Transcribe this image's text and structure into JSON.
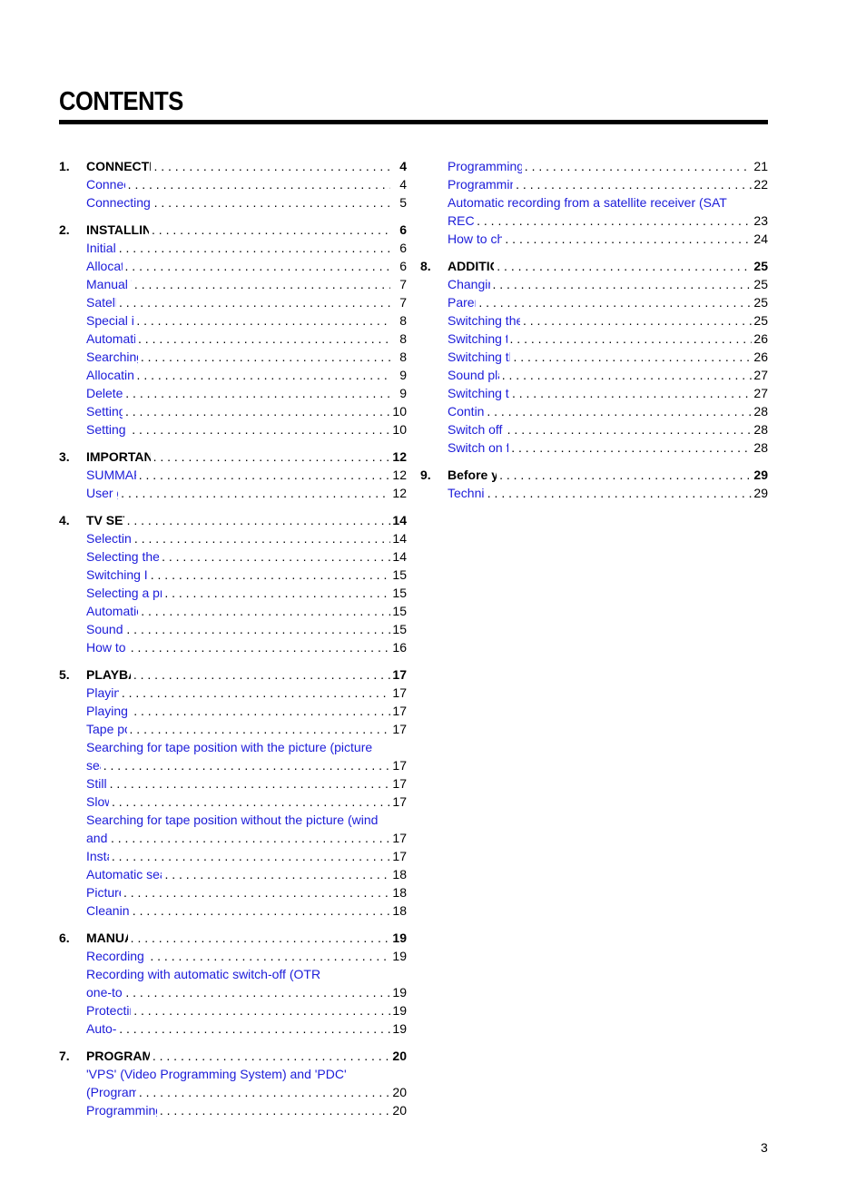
{
  "title": "CONTENTS",
  "page_number": "3",
  "link_color": "#1c1cd9",
  "left_column": [
    {
      "number": "1.",
      "title": "CONNECTING YOUR TV-VIDEO COMBI",
      "page": "4",
      "items": [
        {
          "lines": [
            "Connecting the cables"
          ],
          "page": "4"
        },
        {
          "lines": [
            "Connecting a decoder or other equipment"
          ],
          "page": "5"
        }
      ]
    },
    {
      "number": "2.",
      "title": "INSTALLING YOUR TV-VIDEO COMBI",
      "page": "6",
      "items": [
        {
          "lines": [
            "Initial installation"
          ],
          "page": "6"
        },
        {
          "lines": [
            "Allocating a decoder"
          ],
          "page": "6"
        },
        {
          "lines": [
            "Manual TV channel search"
          ],
          "page": "7"
        },
        {
          "lines": [
            "Satellite receiver"
          ],
          "page": "7"
        },
        {
          "lines": [
            "Special installation functions"
          ],
          "page": "8"
        },
        {
          "lines": [
            "Automatic TV channel search"
          ],
          "page": "8"
        },
        {
          "lines": [
            "Searching for new TV channels"
          ],
          "page": "8"
        },
        {
          "lines": [
            "Allocating a channel number"
          ],
          "page": "9"
        },
        {
          "lines": [
            "Delete a TV Channel"
          ],
          "page": "9"
        },
        {
          "lines": [
            "Setting the language"
          ],
          "page": "10"
        },
        {
          "lines": [
            "Setting the time and date"
          ],
          "page": "10"
        }
      ]
    },
    {
      "number": "3.",
      "title": "IMPORTANT NOTES FOR OPERATION",
      "page": "12",
      "items": [
        {
          "lines": [
            "SUMMARY OF USER GUIDE"
          ],
          "page": "12"
        },
        {
          "lines": [
            "User guide (OSD)"
          ],
          "page": "12"
        }
      ]
    },
    {
      "number": "4.",
      "title": "TV SET FUNCTIONS",
      "page": "14",
      "items": [
        {
          "lines": [
            "Selecting a TV programme"
          ],
          "page": "14"
        },
        {
          "lines": [
            "Selecting the picture setting (SMART PICTURE)"
          ],
          "page": "14"
        },
        {
          "lines": [
            "Switching Incredible Surround on or off"
          ],
          "page": "15"
        },
        {
          "lines": [
            "Selecting a preset sound setting (SMART SOUND)"
          ],
          "page": "15"
        },
        {
          "lines": [
            "Automatic volume control (AVL)"
          ],
          "page": "15"
        },
        {
          "lines": [
            "Sound track selection"
          ],
          "page": "15"
        },
        {
          "lines": [
            "How to read TELETEXT"
          ],
          "page": "16"
        }
      ]
    },
    {
      "number": "5.",
      "title": "PLAYBACK FUNCTIONS",
      "page": "17",
      "items": [
        {
          "lines": [
            "Playing a cassette"
          ],
          "page": "17"
        },
        {
          "lines": [
            "Playing an NTSC cassette"
          ],
          "page": "17"
        },
        {
          "lines": [
            "Tape position indication"
          ],
          "page": "17"
        },
        {
          "lines": [
            "Searching for tape position with the picture (picture",
            "search)"
          ],
          "page": "17"
        },
        {
          "lines": [
            "Still picture"
          ],
          "page": "17"
        },
        {
          "lines": [
            "Slow motion"
          ],
          "page": "17"
        },
        {
          "lines": [
            "Searching for tape position without the picture (wind",
            "and rewind)"
          ],
          "page": "17"
        },
        {
          "lines": [
            "Instant View"
          ],
          "page": "17"
        },
        {
          "lines": [
            "Automatic search for a tape position (index search)"
          ],
          "page": "18"
        },
        {
          "lines": [
            "Picture interference"
          ],
          "page": "18"
        },
        {
          "lines": [
            "Cleaning the video heads"
          ],
          "page": "18"
        }
      ]
    },
    {
      "number": "6.",
      "title": "MANUAL RECORDING",
      "page": "19",
      "items": [
        {
          "lines": [
            "Recording without automatic switch-off"
          ],
          "page": "19"
        },
        {
          "lines": [
            "Recording with automatic switch-off (OTR",
            "one-touch-recording)"
          ],
          "page": "19"
        },
        {
          "lines": [
            "Protecting your recordings"
          ],
          "page": "19"
        },
        {
          "lines": [
            "Auto-assembling"
          ],
          "page": "19"
        }
      ]
    },
    {
      "number": "7.",
      "title": "PROGRAMMED RECORDING (TIMER)",
      "page": "20",
      "items": [
        {
          "lines": [
            "'VPS' (Video Programming System) and 'PDC'",
            "(Programme Delivery Control)"
          ],
          "page": "20"
        },
        {
          "lines": [
            "Programming a recording (with 'VIDEO Plus+')"
          ],
          "page": "20"
        }
      ]
    }
  ],
  "right_column": [
    {
      "number": "",
      "title": "",
      "page": "",
      "items": [
        {
          "lines": [
            "Programming a recording (without 'VIDEO Plus+')"
          ],
          "page": "21"
        },
        {
          "lines": [
            "Programming a recording with TELETEXT"
          ],
          "page": "22"
        },
        {
          "lines": [
            "Automatic recording from a satellite receiver (SAT",
            "RECORDING)"
          ],
          "page": "23"
        },
        {
          "lines": [
            "How to check or change a TIMER"
          ],
          "page": "24"
        }
      ]
    },
    {
      "number": "8.",
      "title": "ADDITIONAL FUNCTIONS",
      "page": "25",
      "items": [
        {
          "lines": [
            "Changing the TV system"
          ],
          "page": "25"
        },
        {
          "lines": [
            "Parental control"
          ],
          "page": "25"
        },
        {
          "lines": [
            "Switching the On-screen display (OSD) on or off"
          ],
          "page": "25"
        },
        {
          "lines": [
            "Switching to 16:9 wide screen picture"
          ],
          "page": "26"
        },
        {
          "lines": [
            "Switching the internal speakers on or off"
          ],
          "page": "26"
        },
        {
          "lines": [
            "Sound playback without picture"
          ],
          "page": "27"
        },
        {
          "lines": [
            "Switching the remote control command"
          ],
          "page": "27"
        },
        {
          "lines": [
            "Continuous playback"
          ],
          "page": "28"
        },
        {
          "lines": [
            "Switch off function (SLEEP TIMER)"
          ],
          "page": "28"
        },
        {
          "lines": [
            "Switch on function (WAKE-UP TIMER)"
          ],
          "page": "28"
        }
      ]
    },
    {
      "number": "9.",
      "title": "Before you call an engineer",
      "page": "29",
      "items": [
        {
          "lines": [
            "Technical terms used"
          ],
          "page": "29"
        }
      ]
    }
  ]
}
